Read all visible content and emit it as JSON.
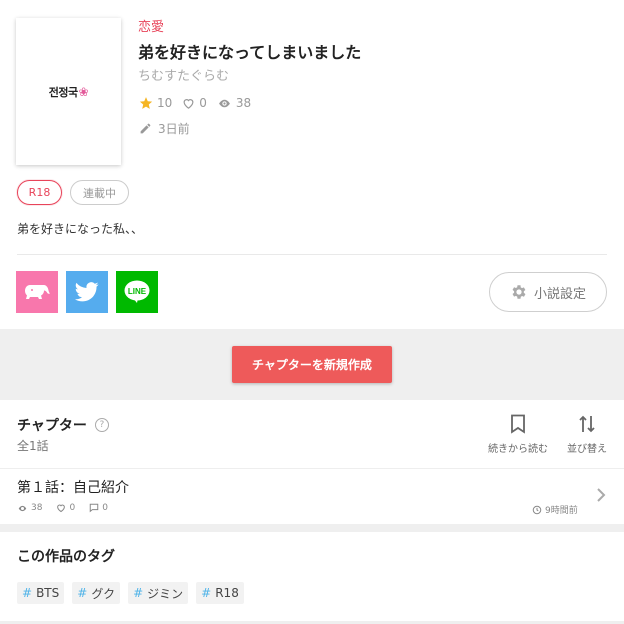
{
  "novel": {
    "cover_text": "전정국",
    "genre": "恋愛",
    "title": "弟を好きになってしまいました",
    "author": "ちむすたぐらむ",
    "stars": "10",
    "likes": "0",
    "views": "38",
    "updated": "3日前",
    "badges": {
      "r18": "R18",
      "status": "連載中"
    },
    "synopsis": "弟を好きになった私、、"
  },
  "share": {
    "buttons": [
      {
        "name": "babyboo-share",
        "color": "#f877ac",
        "icon": "elephant-icon"
      },
      {
        "name": "twitter-share",
        "color": "#55acee",
        "icon": "twitter-bird-icon"
      },
      {
        "name": "line-share",
        "color": "#00b900",
        "icon": "line-logo-icon",
        "label": "LINE"
      }
    ]
  },
  "settings": {
    "label": "小説設定",
    "icon": "gear-icon"
  },
  "new_chapter": {
    "label": "チャプターを新規作成",
    "color": "#ee5a5a"
  },
  "chapters": {
    "heading": "チャプター",
    "help_icon": "?",
    "count": "全1話",
    "actions": {
      "continue": "続きから読む",
      "sort": "並び替え"
    },
    "items": [
      {
        "title": "第１話：自己紹介",
        "views": "38",
        "likes": "0",
        "comments": "0",
        "time": "9時間前"
      }
    ]
  },
  "tags": {
    "heading": "この作品のタグ",
    "hash": "#",
    "items": [
      "BTS",
      "グク",
      "ジミン",
      "R18"
    ]
  },
  "colors": {
    "accent": "#e8445a",
    "tag_hash": "#4fb3e8"
  }
}
